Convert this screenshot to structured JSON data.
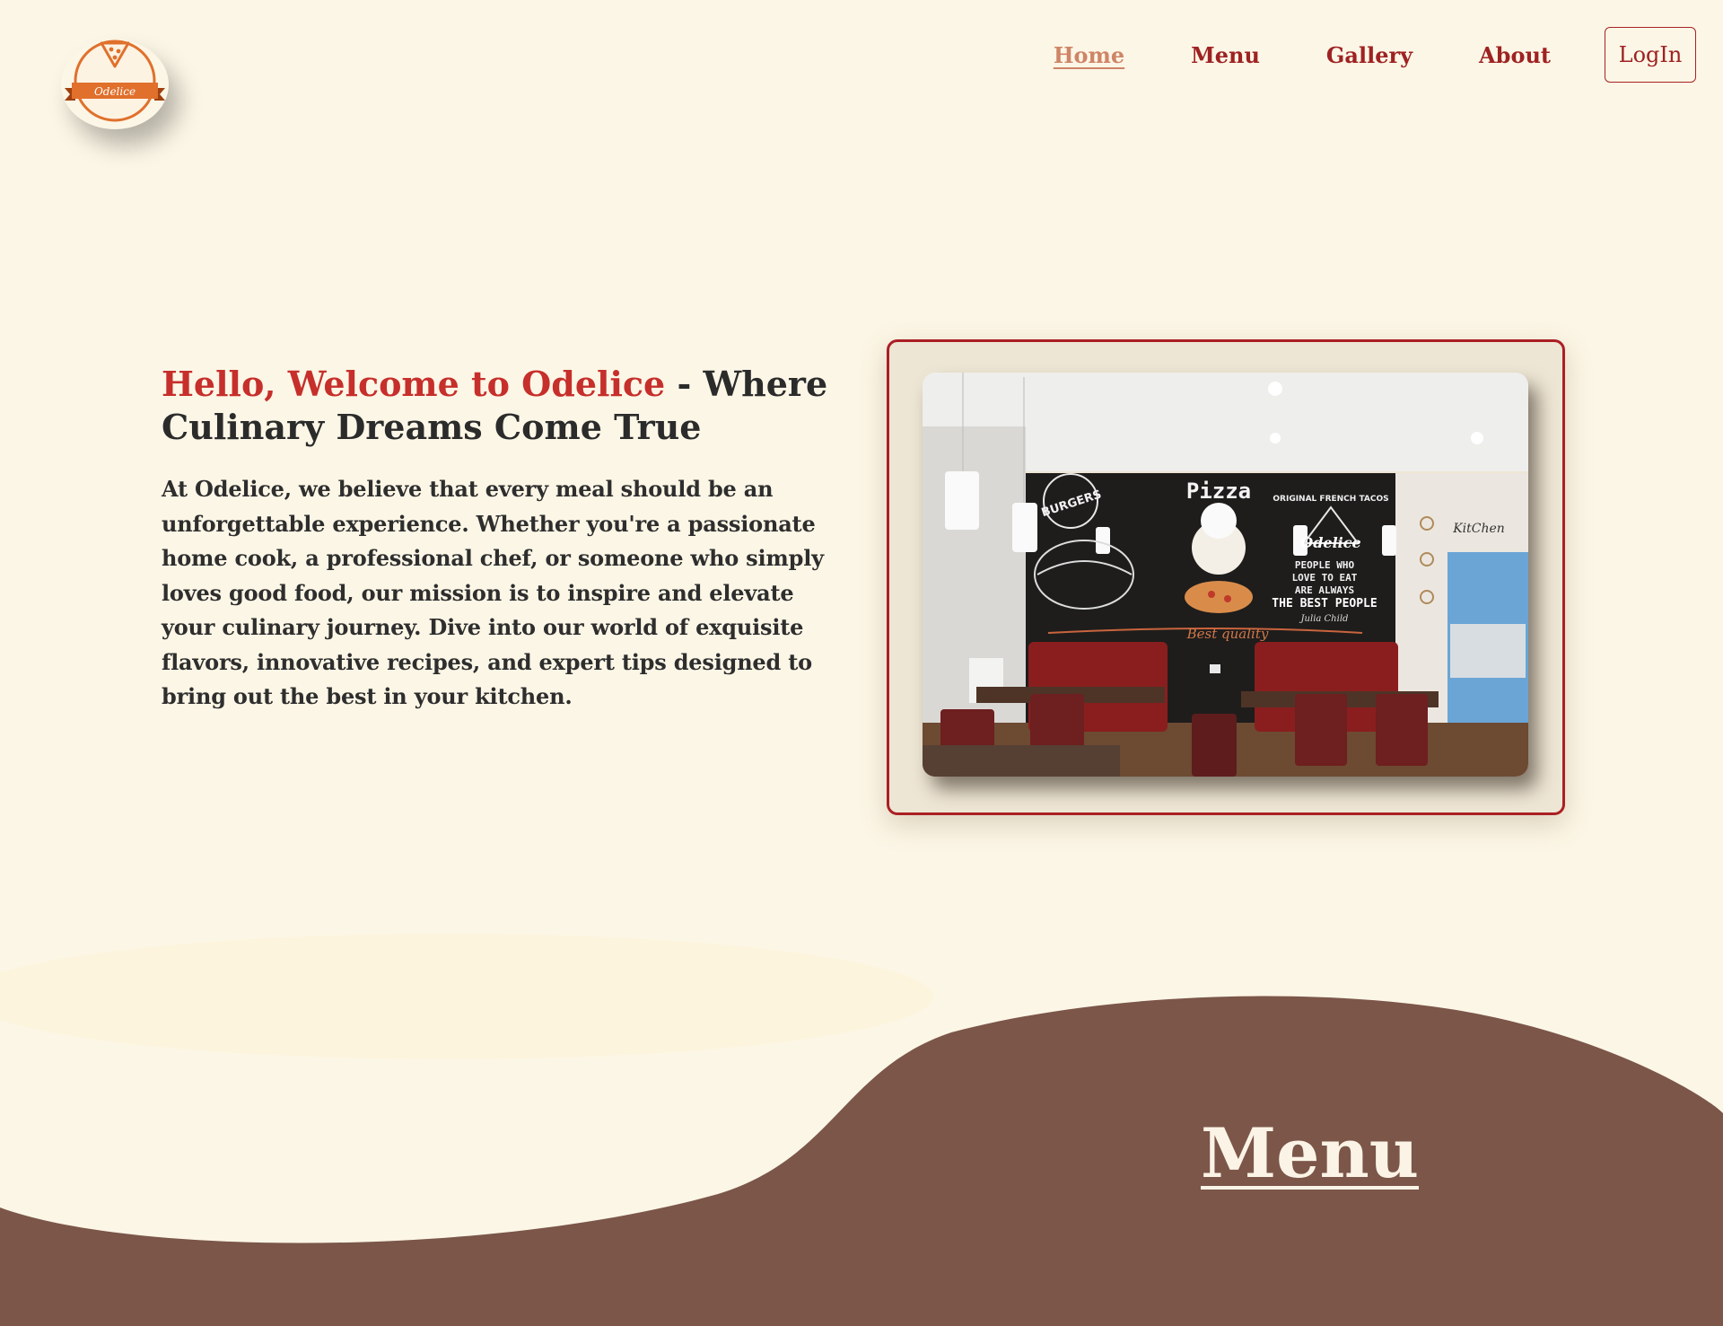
{
  "brand": {
    "logo_text": "Odelice"
  },
  "nav": {
    "items": [
      {
        "label": "Home",
        "active": true
      },
      {
        "label": "Menu",
        "active": false
      },
      {
        "label": "Gallery",
        "active": false
      },
      {
        "label": "About",
        "active": false
      }
    ],
    "login_label": "LogIn"
  },
  "hero": {
    "title_accent": "Hello, Welcome to Odelice",
    "title_rest": " - Where Culinary Dreams Come True",
    "description": "At Odelice, we believe that every meal should be an unforgettable experience. Whether you're a passionate home cook, a professional chef, or someone who simply loves good food, our mission is to inspire and elevate your culinary journey. Dive into our world of exquisite flavors, innovative recipes, and expert tips designed to bring out the best in your kitchen.",
    "image": {
      "signs": {
        "burgers": "BURGERS",
        "pizza": "Pizza",
        "tacos": "ORIGINAL FRENCH TACOS",
        "brand": "Odelice",
        "slogan": [
          "PEOPLE WHO",
          "LOVE TO EAT",
          "ARE ALWAYS",
          "THE BEST PEOPLE"
        ],
        "signature": "Julia Child",
        "quality": "Best quality",
        "kitchen": "KitChen"
      }
    }
  },
  "sections": {
    "menu_title": "Menu"
  },
  "colors": {
    "background": "#fcf6e6",
    "accent_red": "#c62f2b",
    "nav_red": "#9e2222",
    "nav_active": "#cf8467",
    "wave_brown": "#7b5649",
    "logo_orange": "#e0702c"
  }
}
